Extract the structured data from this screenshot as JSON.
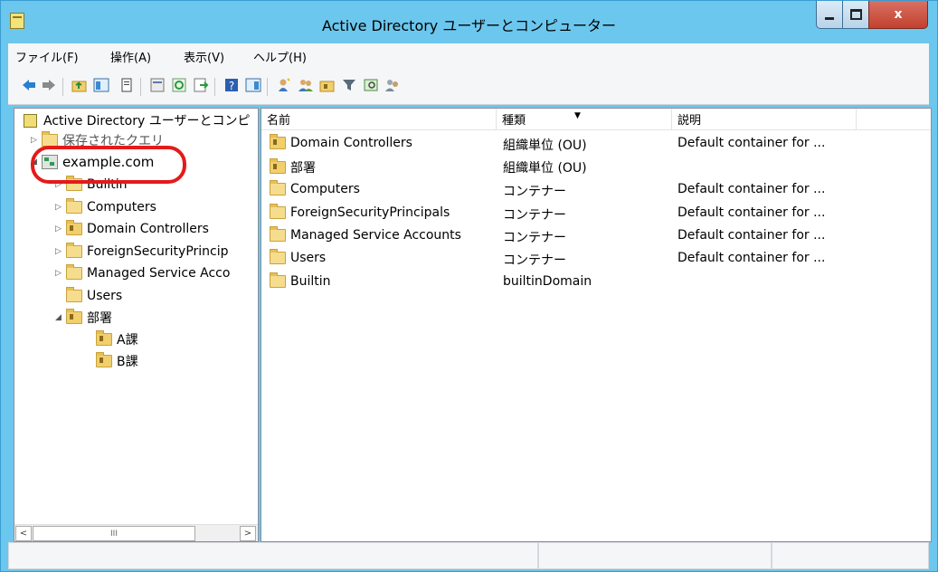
{
  "window": {
    "title": "Active Directory ユーザーとコンピューター",
    "close_label": "x"
  },
  "menu": {
    "items": [
      "ファイル(F)",
      "操作(A)",
      "表示(V)",
      "ヘルプ(H)"
    ]
  },
  "toolbar": {
    "icons": [
      "back-arrow-icon",
      "forward-arrow-icon",
      "up-folder-icon",
      "show-console-tree-icon",
      "properties-icon",
      "export-list-icon",
      "refresh-icon",
      "export-icon",
      "help-icon",
      "show-action-pane-icon",
      "new-user-icon",
      "new-group-icon",
      "new-ou-icon",
      "filter-icon",
      "find-icon",
      "delegate-icon"
    ]
  },
  "tree": {
    "root": "Active Directory ユーザーとコンピ",
    "saved_queries": "保存されたクエリ",
    "domain": "example.com",
    "children": [
      {
        "label": "Builtin",
        "expander": "▷"
      },
      {
        "label": "Computers",
        "expander": "▷"
      },
      {
        "label": "Domain Controllers",
        "expander": "▷"
      },
      {
        "label": "ForeignSecurityPrincip",
        "expander": "▷"
      },
      {
        "label": "Managed Service Acco",
        "expander": "▷"
      },
      {
        "label": "Users",
        "expander": ""
      },
      {
        "label": "部署",
        "expander": "◢"
      }
    ],
    "sub_children": [
      "A課",
      "B課"
    ],
    "scroll_thumb": "III"
  },
  "list": {
    "columns": [
      "名前",
      "種類",
      "説明"
    ],
    "rows": [
      {
        "name": "Domain Controllers",
        "type": "組織単位 (OU)",
        "desc": "Default container for ..."
      },
      {
        "name": "部署",
        "type": "組織単位 (OU)",
        "desc": ""
      },
      {
        "name": "Computers",
        "type": "コンテナー",
        "desc": "Default container for ..."
      },
      {
        "name": "ForeignSecurityPrincipals",
        "type": "コンテナー",
        "desc": "Default container for ..."
      },
      {
        "name": "Managed Service Accounts",
        "type": "コンテナー",
        "desc": "Default container for ..."
      },
      {
        "name": "Users",
        "type": "コンテナー",
        "desc": "Default container for ..."
      },
      {
        "name": "Builtin",
        "type": "builtinDomain",
        "desc": ""
      }
    ]
  },
  "annotation": {
    "color": "#e51a1a"
  }
}
